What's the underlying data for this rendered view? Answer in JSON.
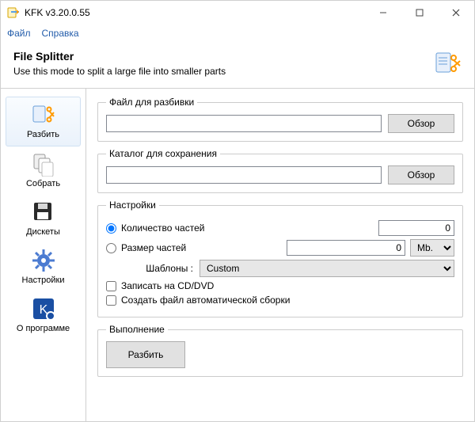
{
  "titlebar": {
    "title": "KFK v3.20.0.55"
  },
  "menubar": {
    "file": "Файл",
    "help": "Справка"
  },
  "header": {
    "title": "File Splitter",
    "subtitle": "Use this mode to split a large file into smaller parts"
  },
  "sidebar": {
    "items": [
      {
        "label": "Разбить"
      },
      {
        "label": "Собрать"
      },
      {
        "label": "Дискеты"
      },
      {
        "label": "Настройки"
      },
      {
        "label": "О программе"
      }
    ]
  },
  "main": {
    "file_group": {
      "legend": "Файл для разбивки",
      "value": "",
      "browse": "Обзор"
    },
    "dest_group": {
      "legend": "Каталог для сохранения",
      "value": "",
      "browse": "Обзор"
    },
    "settings": {
      "legend": "Настройки",
      "by_count_label": "Количество частей",
      "by_count_value": "0",
      "by_size_label": "Размер частей",
      "by_size_value": "0",
      "size_unit": "Mb.",
      "templates_label": "Шаблоны :",
      "template_value": "Custom",
      "burn_label": "Записать на CD/DVD",
      "autorebuild_label": "Создать файл автоматической сборки"
    },
    "execution": {
      "legend": "Выполнение",
      "split_button": "Разбить"
    }
  },
  "icons": {
    "app": "kfk-icon",
    "header": "split-icon"
  }
}
